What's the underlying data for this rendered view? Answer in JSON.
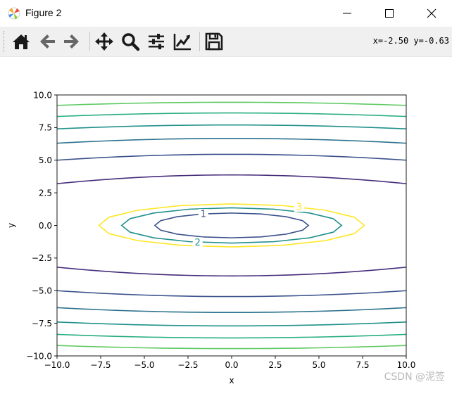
{
  "window": {
    "title": "Figure 2",
    "app_icon": "matplotlib-icon",
    "controls": [
      "minimize-icon",
      "maximize-icon",
      "close-icon"
    ]
  },
  "toolbar": {
    "tools": [
      "home-icon",
      "back-arrow-icon",
      "forward-arrow-icon",
      "pan-move-icon",
      "zoom-magnifier-icon",
      "configure-subplots-icon",
      "edit-axis-curve-icon",
      "save-floppy-icon"
    ],
    "coords_text": "x=-2.50 y=-0.63"
  },
  "watermark": "CSDN @泥签",
  "chart_data": {
    "type": "contour",
    "title": "",
    "xlabel": "x",
    "ylabel": "y",
    "xlim": [
      -10,
      10
    ],
    "ylim": [
      -10,
      10
    ],
    "xticks": [
      "−10.0",
      "−7.5",
      "−5.0",
      "−2.5",
      "0.0",
      "2.5",
      "5.0",
      "7.5",
      "10.0"
    ],
    "yticks": [
      "10.0",
      "7.5",
      "5.0",
      "2.5",
      "0.0",
      "−2.5",
      "−5.0",
      "−7.5",
      "−10.0"
    ],
    "grid": false,
    "legend": "none",
    "colormap": "viridis",
    "levels": [
      {
        "label": "1",
        "color": "#3b528b",
        "closed": true,
        "x_half": 4.4,
        "y_half": 0.95
      },
      {
        "label": "2",
        "color": "#21918c",
        "closed": true,
        "x_half": 6.3,
        "y_half": 1.35
      },
      {
        "label": "3",
        "color": "#fde725",
        "closed": true,
        "x_half": 7.6,
        "y_half": 1.65
      },
      {
        "label": "",
        "color": "#472d7b",
        "closed": false,
        "y_center": 3.87,
        "y_edge": 3.2
      },
      {
        "label": "",
        "color": "#3b528b",
        "closed": false,
        "y_center": 5.45,
        "y_edge": 5.0
      },
      {
        "label": "",
        "color": "#2c728e",
        "closed": false,
        "y_center": 6.67,
        "y_edge": 6.3
      },
      {
        "label": "",
        "color": "#21918c",
        "closed": false,
        "y_center": 7.7,
        "y_edge": 7.4
      },
      {
        "label": "",
        "color": "#28ae80",
        "closed": false,
        "y_center": 8.62,
        "y_edge": 8.35
      },
      {
        "label": "",
        "color": "#5ec962",
        "closed": false,
        "y_center": 9.44,
        "y_edge": 9.2
      }
    ]
  }
}
